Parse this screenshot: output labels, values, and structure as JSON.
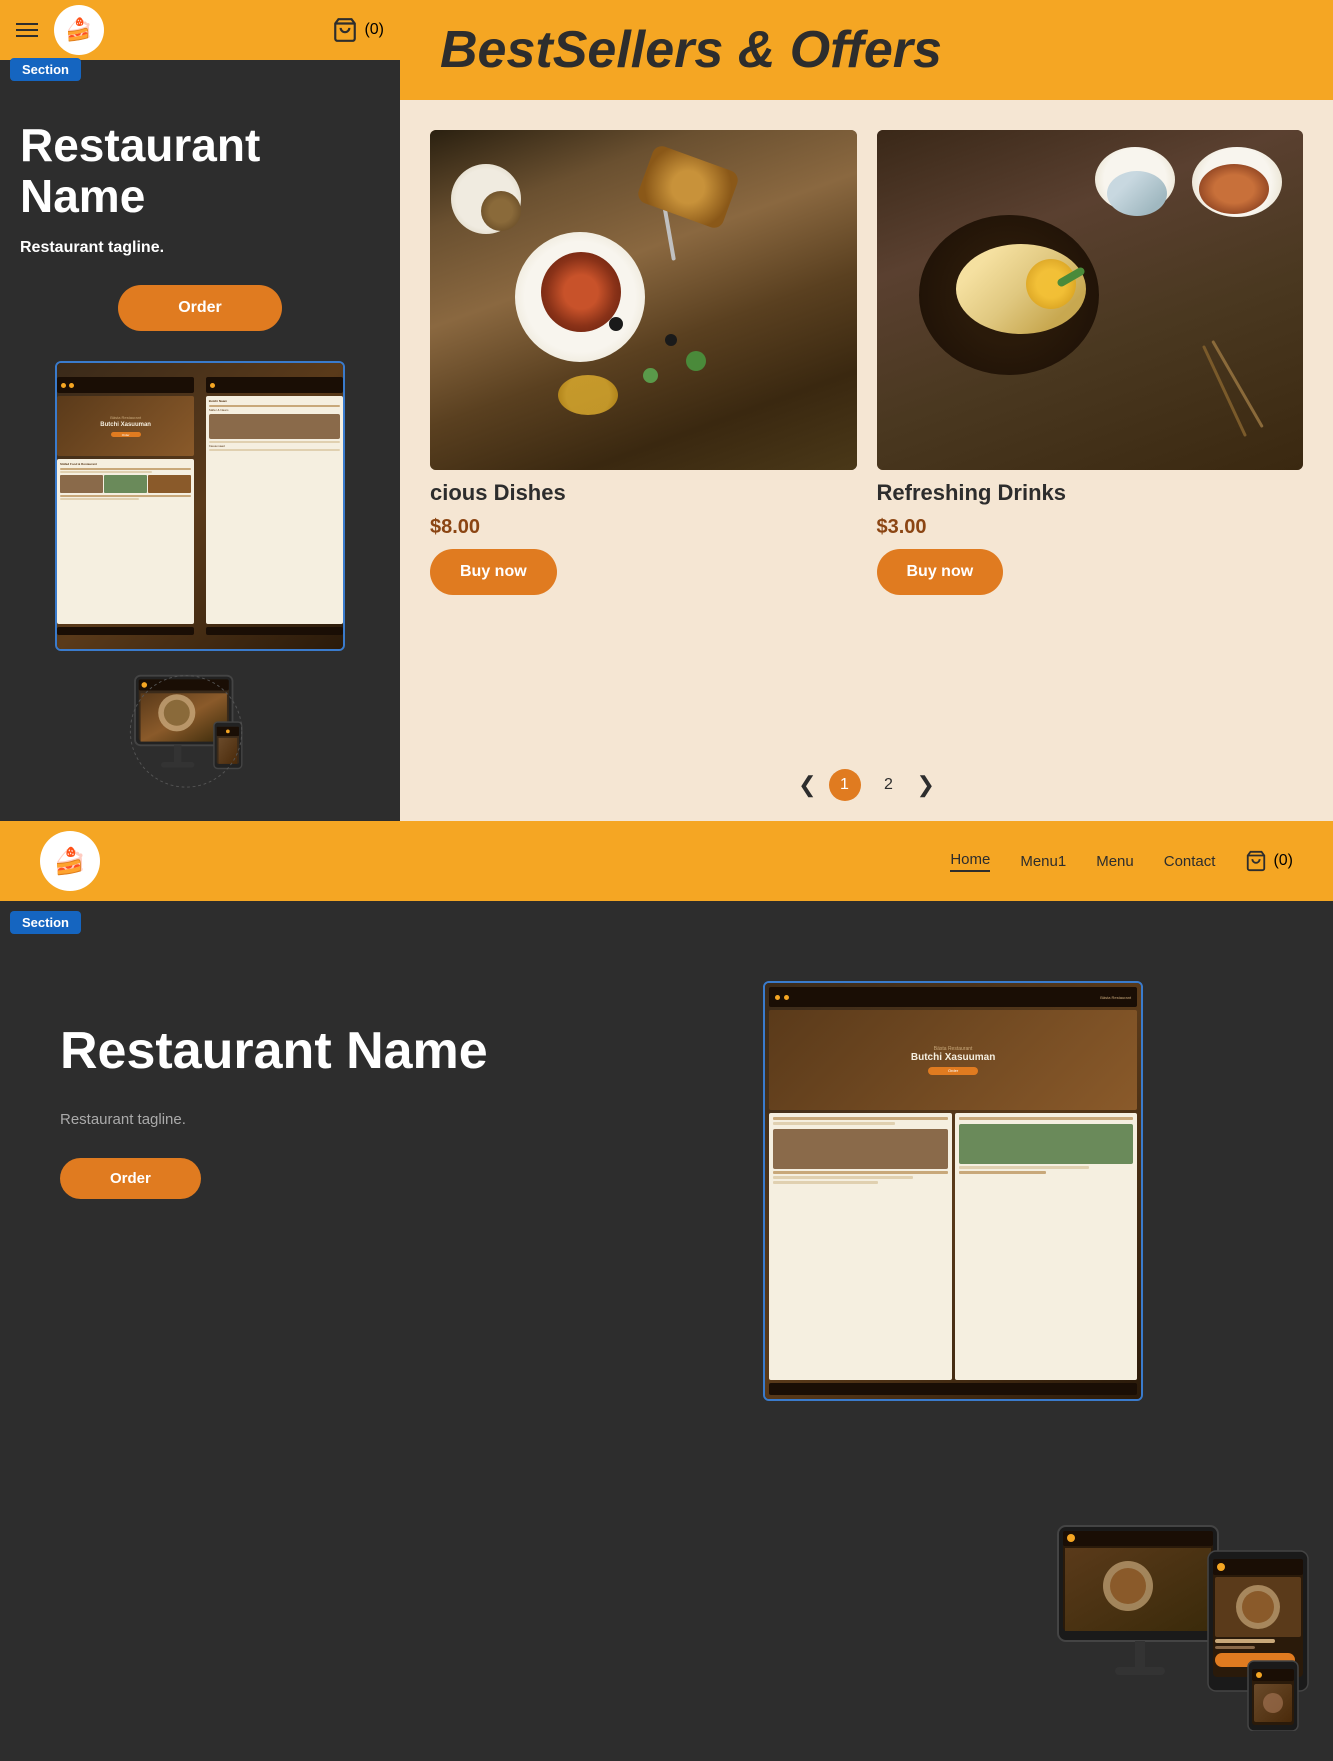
{
  "topBar": {
    "logoEmoji": "🍰",
    "cartCount": "(0)"
  },
  "leftPanel": {
    "sectionBadge": "Section",
    "restaurantName": "Restaurant Name",
    "tagline": "Restaurant tagline.",
    "orderBtn": "Order"
  },
  "rightPanel": {
    "title": "BestSellers & Offers",
    "products": [
      {
        "name": "cious Dishes",
        "price": "$8.00",
        "buyBtn": "Buy now"
      },
      {
        "name": "Refreshing Drinks",
        "price": "$3.00",
        "buyBtn": "Buy now"
      }
    ],
    "pagination": {
      "prev": "❮",
      "next": "❯",
      "pages": [
        "1",
        "2"
      ],
      "activePage": "1"
    }
  },
  "navbar": {
    "logoEmoji": "🍰",
    "items": [
      "Home",
      "Menu1",
      "Menu",
      "Contact"
    ],
    "activeItem": "Home",
    "cartCount": "(0)"
  },
  "secondSection": {
    "sectionBadge": "Section",
    "restaurantName": "Restaurant Name",
    "tagline": "Restaurant tagline.",
    "orderBtn": "Order"
  }
}
